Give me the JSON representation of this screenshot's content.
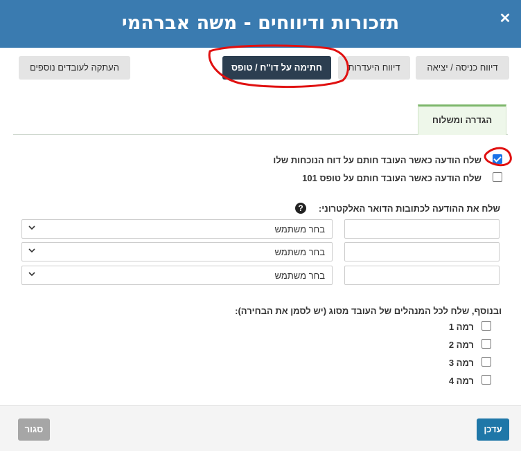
{
  "dialog": {
    "title": "תזכורות ודיווחים - משה אברהמי",
    "close_symbol": "✕"
  },
  "toolbar": {
    "buttons": [
      {
        "label": "דיווח כניסה / יציאה",
        "active": false
      },
      {
        "label": "דיווח היעדרות",
        "active": false
      },
      {
        "label": "חתימה על דו\"ח / טופס",
        "active": true
      },
      {
        "label": "העתקה לעובדים נוספים",
        "active": false
      }
    ]
  },
  "tabs": [
    {
      "label": "הגדרה ומשלוח",
      "active": true
    }
  ],
  "notifications": [
    {
      "label": "שלח הודעה כאשר העובד חותם על דוח הנוכחות שלו",
      "checked": true
    },
    {
      "label": "שלח הודעה כאשר העובד חותם על טופס 101",
      "checked": false
    }
  ],
  "email_section": {
    "label": "שלח את ההודעה לכתובות הדואר האלקטרוני:",
    "help_icon": "question-circle-icon",
    "help_symbol": "?",
    "rows": [
      {
        "email_value": "",
        "user_select": "בחר משתמש"
      },
      {
        "email_value": "",
        "user_select": "בחר משתמש"
      },
      {
        "email_value": "",
        "user_select": "בחר משתמש"
      }
    ]
  },
  "managers_section": {
    "label": "ובנוסף, שלח לכל המנהלים של העובד מסוג (יש לסמן את הבחירה):",
    "levels": [
      {
        "label": "רמה 1",
        "checked": false
      },
      {
        "label": "רמה 2",
        "checked": false
      },
      {
        "label": "רמה 3",
        "checked": false
      },
      {
        "label": "רמה 4",
        "checked": false
      }
    ]
  },
  "footer": {
    "update_label": "עדכן",
    "close_label": "סגור"
  },
  "colors": {
    "header_bg": "#3a7bb0",
    "active_button_bg": "#2c3e50",
    "update_button_bg": "#1f77a8",
    "close_button_bg": "#a6a6a6",
    "tab_accent": "#7cb66a",
    "annotation_red": "#e01010"
  }
}
